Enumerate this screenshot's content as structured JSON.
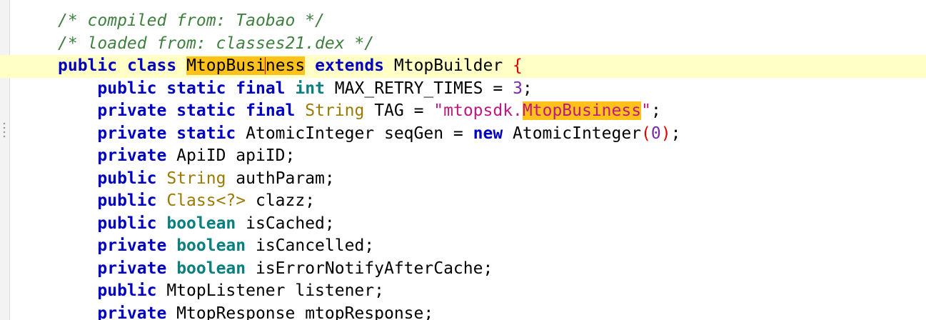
{
  "editor": {
    "lines": [
      [
        {
          "t": "/* compiled from: Taobao */",
          "k": "comment"
        }
      ],
      [
        {
          "t": "/* loaded from: classes21.dex */",
          "k": "comment"
        }
      ],
      [
        {
          "t": "public",
          "k": "kw"
        },
        {
          "t": " ",
          "k": "ident"
        },
        {
          "t": "class",
          "k": "kw"
        },
        {
          "t": " ",
          "k": "ident"
        },
        {
          "t": "MtopBusi",
          "k": "ident",
          "hl": true,
          "caretAfter": true
        },
        {
          "t": "ness",
          "k": "ident",
          "hl": true
        },
        {
          "t": " ",
          "k": "ident"
        },
        {
          "t": "extends",
          "k": "kw"
        },
        {
          "t": " MtopBuilder ",
          "k": "ident"
        },
        {
          "t": "{",
          "k": "brace"
        }
      ],
      [
        {
          "t": "    ",
          "k": "ident"
        },
        {
          "t": "public",
          "k": "kw"
        },
        {
          "t": " ",
          "k": "ident"
        },
        {
          "t": "static",
          "k": "kw"
        },
        {
          "t": " ",
          "k": "ident"
        },
        {
          "t": "final",
          "k": "kw"
        },
        {
          "t": " ",
          "k": "ident"
        },
        {
          "t": "int",
          "k": "prim"
        },
        {
          "t": " MAX_RETRY_TIMES = ",
          "k": "ident"
        },
        {
          "t": "3",
          "k": "num"
        },
        {
          "t": ";",
          "k": "ident"
        }
      ],
      [
        {
          "t": "    ",
          "k": "ident"
        },
        {
          "t": "private",
          "k": "kw"
        },
        {
          "t": " ",
          "k": "ident"
        },
        {
          "t": "static",
          "k": "kw"
        },
        {
          "t": " ",
          "k": "ident"
        },
        {
          "t": "final",
          "k": "kw"
        },
        {
          "t": " ",
          "k": "ident"
        },
        {
          "t": "String",
          "k": "lib"
        },
        {
          "t": " TAG = ",
          "k": "ident"
        },
        {
          "t": "\"mtopsdk.",
          "k": "string"
        },
        {
          "t": "MtopBusiness",
          "k": "string",
          "hl": true
        },
        {
          "t": "\"",
          "k": "string"
        },
        {
          "t": ";",
          "k": "ident"
        }
      ],
      [
        {
          "t": "    ",
          "k": "ident"
        },
        {
          "t": "private",
          "k": "kw"
        },
        {
          "t": " ",
          "k": "ident"
        },
        {
          "t": "static",
          "k": "kw"
        },
        {
          "t": " AtomicInteger seqGen = ",
          "k": "ident"
        },
        {
          "t": "new",
          "k": "kw"
        },
        {
          "t": " AtomicInteger",
          "k": "ident"
        },
        {
          "t": "(",
          "k": "brace"
        },
        {
          "t": "0",
          "k": "num"
        },
        {
          "t": ")",
          "k": "brace"
        },
        {
          "t": ";",
          "k": "ident"
        }
      ],
      [
        {
          "t": "    ",
          "k": "ident"
        },
        {
          "t": "private",
          "k": "kw"
        },
        {
          "t": " ApiID apiID;",
          "k": "ident"
        }
      ],
      [
        {
          "t": "    ",
          "k": "ident"
        },
        {
          "t": "public",
          "k": "kw"
        },
        {
          "t": " ",
          "k": "ident"
        },
        {
          "t": "String",
          "k": "lib"
        },
        {
          "t": " authParam;",
          "k": "ident"
        }
      ],
      [
        {
          "t": "    ",
          "k": "ident"
        },
        {
          "t": "public",
          "k": "kw"
        },
        {
          "t": " ",
          "k": "ident"
        },
        {
          "t": "Class<?>",
          "k": "lib"
        },
        {
          "t": " clazz;",
          "k": "ident"
        }
      ],
      [
        {
          "t": "    ",
          "k": "ident"
        },
        {
          "t": "public",
          "k": "kw"
        },
        {
          "t": " ",
          "k": "ident"
        },
        {
          "t": "boolean",
          "k": "prim"
        },
        {
          "t": " isCached;",
          "k": "ident"
        }
      ],
      [
        {
          "t": "    ",
          "k": "ident"
        },
        {
          "t": "private",
          "k": "kw"
        },
        {
          "t": " ",
          "k": "ident"
        },
        {
          "t": "boolean",
          "k": "prim"
        },
        {
          "t": " isCancelled;",
          "k": "ident"
        }
      ],
      [
        {
          "t": "    ",
          "k": "ident"
        },
        {
          "t": "private",
          "k": "kw"
        },
        {
          "t": " ",
          "k": "ident"
        },
        {
          "t": "boolean",
          "k": "prim"
        },
        {
          "t": " isErrorNotifyAfterCache;",
          "k": "ident"
        }
      ],
      [
        {
          "t": "    ",
          "k": "ident"
        },
        {
          "t": "public",
          "k": "kw"
        },
        {
          "t": " MtopListener listener;",
          "k": "ident"
        }
      ],
      [
        {
          "t": "    ",
          "k": "ident"
        },
        {
          "t": "private",
          "k": "kw"
        },
        {
          "t": " MtopResponse mtopResponse;",
          "k": "ident"
        }
      ]
    ],
    "current_line": 2,
    "colors": {
      "comment": "#3f7f3f",
      "keyword": "#0000c0",
      "primitive": "#0a7f7f",
      "library_type": "#9a7a00",
      "string": "#c0187f",
      "number": "#7a2aa8",
      "brace": "#e00000",
      "occurrence_highlight": "#ffc21a",
      "current_line_bg": "#ffffc6",
      "caret": "#d00000"
    }
  }
}
